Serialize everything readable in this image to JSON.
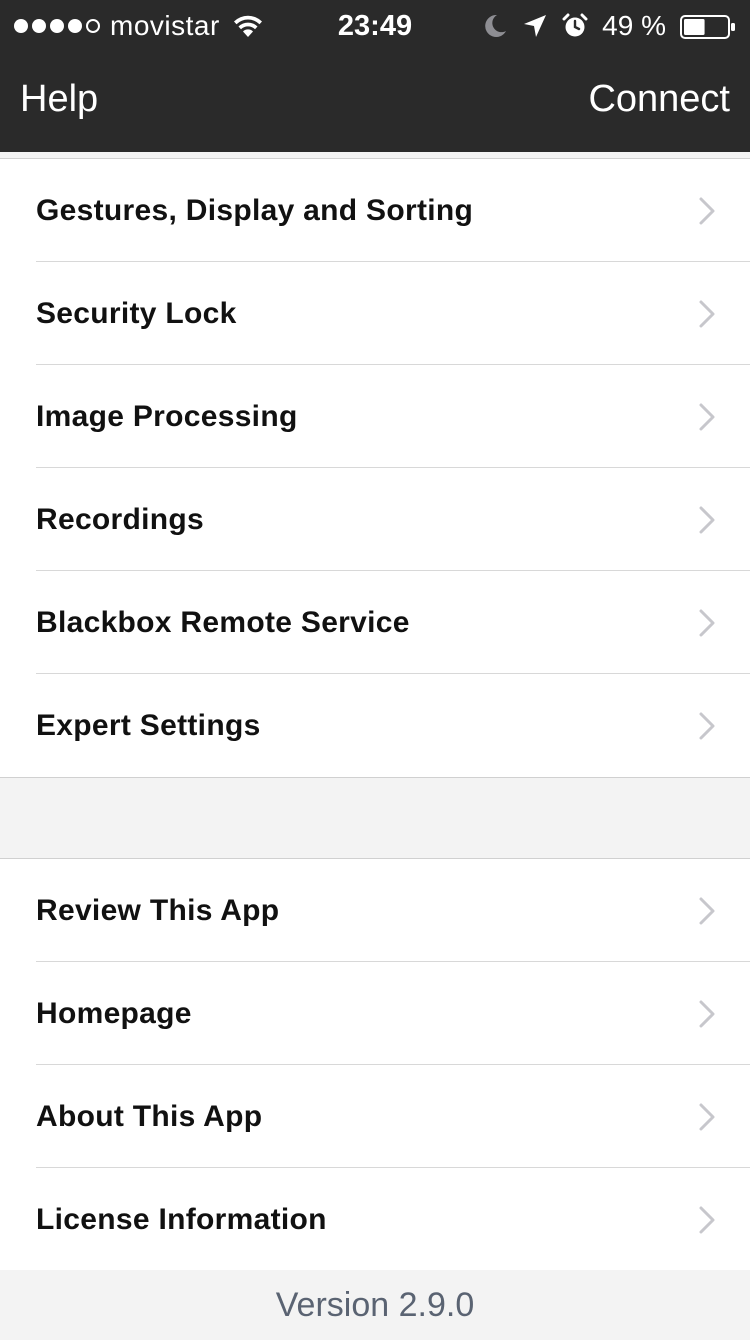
{
  "status_bar": {
    "carrier": "movistar",
    "time": "23:49",
    "battery_percent": "49 %",
    "battery_level": 0.49,
    "icons": [
      "signal-dots",
      "wifi-icon",
      "moon-icon",
      "location-icon",
      "alarm-icon",
      "battery-icon"
    ]
  },
  "nav": {
    "left_label": "Help",
    "right_label": "Connect"
  },
  "groups": [
    {
      "items": [
        {
          "label": "Gestures, Display and Sorting"
        },
        {
          "label": "Security Lock"
        },
        {
          "label": "Image Processing"
        },
        {
          "label": "Recordings"
        },
        {
          "label": "Blackbox Remote Service"
        },
        {
          "label": "Expert Settings"
        }
      ]
    },
    {
      "items": [
        {
          "label": "Review This App"
        },
        {
          "label": "Homepage"
        },
        {
          "label": "About This App"
        },
        {
          "label": "License Information"
        }
      ]
    }
  ],
  "footer": {
    "version": "Version 2.9.0"
  },
  "colors": {
    "header_bg": "#2a2a2a",
    "background": "#f3f3f3",
    "chevron": "#c7c7cc",
    "footer_text": "#5a6372"
  }
}
